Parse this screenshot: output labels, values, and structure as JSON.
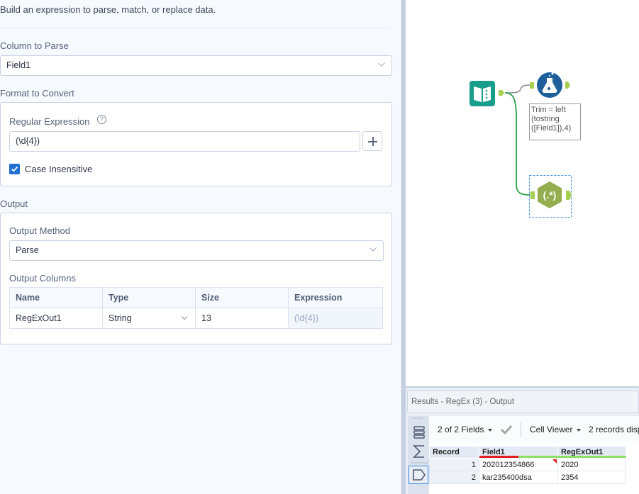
{
  "config": {
    "description": "Build an expression to parse, match, or replace data.",
    "column_to_parse": {
      "label": "Column to Parse",
      "value": "Field1"
    },
    "format_to_convert": {
      "label": "Format to Convert",
      "regex_label": "Regular Expression",
      "regex_value": "(\\d{4})",
      "help_icon": "?",
      "insert_button_icon": "plus-icon",
      "case_insensitive": {
        "label": "Case Insensitive",
        "checked": true
      }
    },
    "output": {
      "label": "Output",
      "method_label": "Output Method",
      "method_value": "Parse",
      "columns_label": "Output Columns",
      "columns_headers": [
        "Name",
        "Type",
        "Size",
        "Expression"
      ],
      "columns_rows": [
        {
          "name": "RegExOut1",
          "type": "String",
          "size": "13",
          "expression": "(\\d{4})"
        }
      ]
    }
  },
  "canvas": {
    "tools": [
      {
        "name": "Input Data",
        "icon": "book-icon",
        "color": "#1a9e8c"
      },
      {
        "name": "Formula",
        "icon": "flask-icon",
        "color": "#1f5f9c"
      },
      {
        "name": "RegEx",
        "icon": "regex-icon",
        "label": "(.*)",
        "color": "#93ad4f",
        "selected": true
      }
    ],
    "annotation": "Trim = left (tostring ([Field1]),4)"
  },
  "results": {
    "title": "Results - RegEx (3) - Output",
    "fields_selector": "2 of 2 Fields",
    "cell_viewer": "Cell Viewer",
    "records_text": "2 records disp",
    "headers": [
      "Record",
      "Field1",
      "RegExOut1"
    ],
    "rows": [
      {
        "record": "1",
        "field1": "202012354866",
        "regexout1": "2020"
      },
      {
        "record": "2",
        "field1": "kar235400dsa",
        "regexout1": "2354"
      }
    ],
    "colors": {
      "quality_good": "#8ee06b",
      "quality_bad": "#e02020"
    }
  }
}
